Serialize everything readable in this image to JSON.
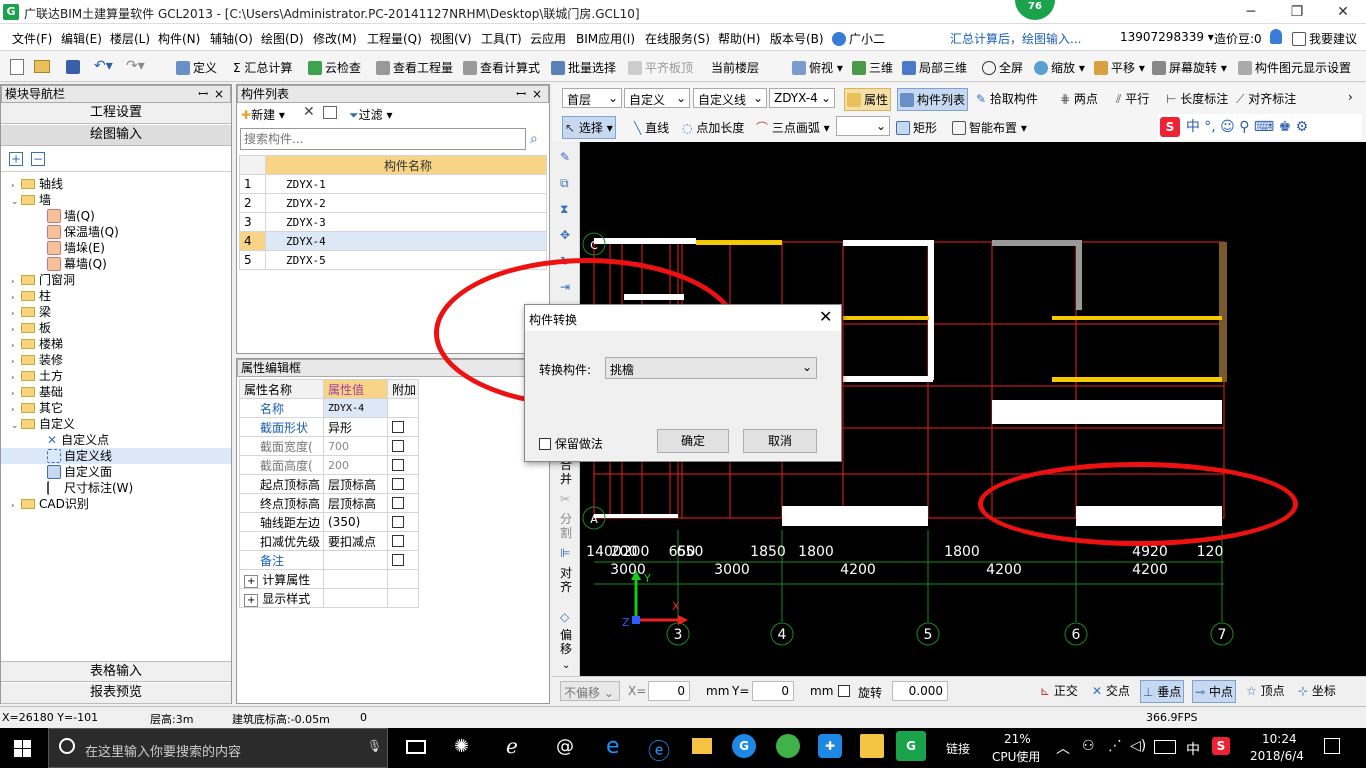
{
  "title": {
    "text": "广联达BIM土建算量软件 GCL2013 - [C:\\Users\\Administrator.PC-20141127NRHM\\Desktop\\联城门房.GCL10]",
    "badge": "76"
  },
  "menubar": {
    "items": [
      "文件(F)",
      "编辑(E)",
      "楼层(L)",
      "构件(N)",
      "辅轴(O)",
      "绘图(D)",
      "修改(M)",
      "工程量(Q)",
      "视图(V)",
      "工具(T)",
      "云应用",
      "BIM应用(I)",
      "在线服务(S)",
      "帮助(H)",
      "版本号(B)",
      "广小二"
    ],
    "notice": "汇总计算后，绘图输入...",
    "phone": "13907298339",
    "bean": "造价豆:0",
    "suggest": "我要建议"
  },
  "toolbar1": {
    "items": [
      "定义",
      "汇总计算",
      "云检查",
      "查看工程量",
      "查看计算式",
      "批量选择",
      "平齐板顶",
      "当前楼层",
      "俯视",
      "三维",
      "局部三维",
      "全屏",
      "缩放",
      "平移",
      "屏幕旋转",
      "构件图元显示设置"
    ]
  },
  "left_panel": {
    "title": "模块导航栏",
    "btn_project": "工程设置",
    "btn_draw": "绘图输入",
    "tree": [
      "轴线",
      "墙",
      "墙(Q)",
      "保温墙(Q)",
      "墙垛(E)",
      "幕墙(Q)",
      "门窗洞",
      "柱",
      "梁",
      "板",
      "楼梯",
      "装修",
      "土方",
      "基础",
      "其它",
      "自定义",
      "自定义点",
      "自定义线",
      "自定义面",
      "尺寸标注(W)",
      "CAD识别"
    ],
    "btn_table": "表格输入",
    "btn_report": "报表预览"
  },
  "component_list": {
    "title": "构件列表",
    "new_label": "新建",
    "filter_label": "过滤",
    "search_placeholder": "搜索构件...",
    "column": "构件名称",
    "rows": [
      {
        "no": "1",
        "name": "ZDYX-1"
      },
      {
        "no": "2",
        "name": "ZDYX-2"
      },
      {
        "no": "3",
        "name": "ZDYX-3"
      },
      {
        "no": "4",
        "name": "ZDYX-4"
      },
      {
        "no": "5",
        "name": "ZDYX-5"
      }
    ]
  },
  "property_box": {
    "title": "属性编辑框",
    "headers": [
      "属性名称",
      "属性值",
      "附加"
    ],
    "rows": [
      {
        "name": "名称",
        "value": "ZDYX-4"
      },
      {
        "name": "截面形状",
        "value": "异形"
      },
      {
        "name": "截面宽度(",
        "value": "700"
      },
      {
        "name": "截面高度(",
        "value": "200"
      },
      {
        "name": "起点顶标高",
        "value": "层顶标高"
      },
      {
        "name": "终点顶标高",
        "value": "层顶标高"
      },
      {
        "name": "轴线距左边",
        "value": "(350)"
      },
      {
        "name": "扣减优先级",
        "value": "要扣减点"
      },
      {
        "name": "备注",
        "value": ""
      },
      {
        "name": "计算属性",
        "value": ""
      },
      {
        "name": "显示样式",
        "value": ""
      }
    ]
  },
  "cad_toolbar": {
    "floor": "首层",
    "type1": "自定义",
    "type2": "自定义线",
    "component": "ZDYX-4",
    "items": [
      "属性",
      "构件列表",
      "拾取构件",
      "两点",
      "平行",
      "长度标注",
      "对齐标注"
    ],
    "row2": [
      "选择",
      "直线",
      "点加长度",
      "三点画弧",
      "矩形",
      "智能布置"
    ]
  },
  "vtool": [
    "合并",
    "分割",
    "对齐",
    "偏移"
  ],
  "canvas": {
    "dims_top": [
      "1400",
      "200",
      "200",
      "650",
      "650",
      "1850",
      "1800",
      "1800",
      "4920",
      "120"
    ],
    "dims_bottom": [
      "3000",
      "3000",
      "4200",
      "4200",
      "4200"
    ],
    "axes": [
      "3",
      "4",
      "5",
      "6",
      "7"
    ],
    "rows": [
      "C",
      "A"
    ]
  },
  "dialog": {
    "title": "构件转换",
    "label": "转换构件:",
    "value": "挑檐",
    "checkbox": "保留做法",
    "ok": "确定",
    "cancel": "取消"
  },
  "bottombar": {
    "offset": "不偏移",
    "x_label": "X=",
    "x_value": "0",
    "unit": "mm",
    "y_label": "Y=",
    "y_value": "0",
    "rotate": "旋转",
    "rotate_value": "0.000",
    "snaps": [
      "正交",
      "交点",
      "垂点",
      "中点",
      "顶点",
      "坐标"
    ]
  },
  "status": {
    "coords": "X=26180 Y=-101",
    "floor_height": "层高:3m",
    "base_elev": "建筑底标高:-0.05m",
    "zero": "0",
    "fps": "366.9FPS"
  },
  "taskbar": {
    "search_placeholder": "在这里输入你要搜索的内容",
    "link": "链接",
    "cpu_pct": "21%",
    "cpu_label": "CPU使用",
    "ime": "中",
    "time": "10:24",
    "date": "2018/6/4"
  }
}
